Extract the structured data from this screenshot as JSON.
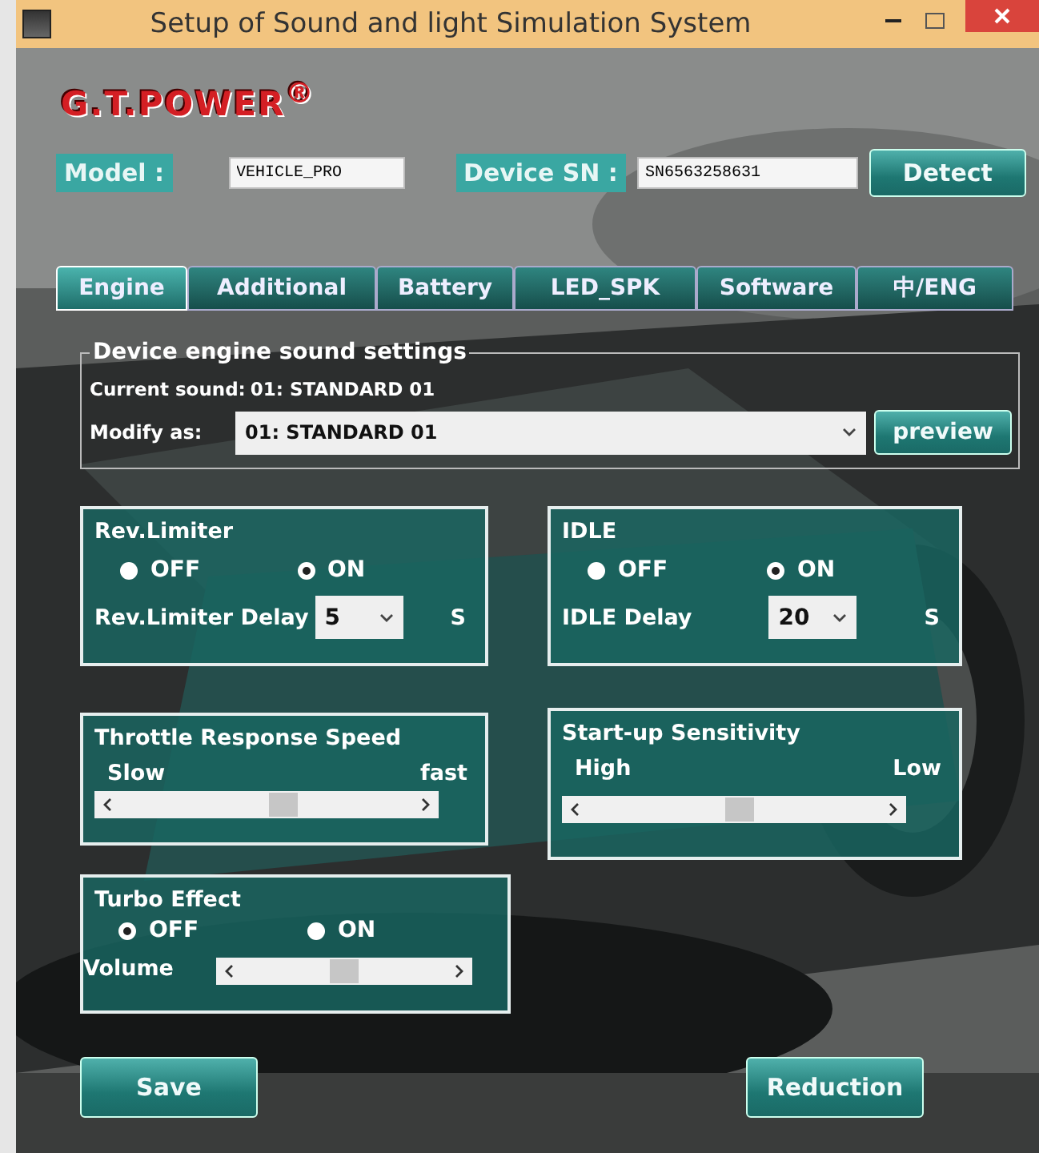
{
  "window": {
    "title": "Setup of Sound and light Simulation System"
  },
  "logo": {
    "text": "G.T.POWER$^{®}$"
  },
  "device": {
    "model_label": "Model :",
    "model_value": "VEHICLE_PRO",
    "sn_label": "Device SN :",
    "sn_value": "SN6563258631",
    "detect_button": "Detect"
  },
  "tabs": [
    {
      "label": "Engine",
      "selected": true
    },
    {
      "label": "Additional",
      "selected": false
    },
    {
      "label": "Battery",
      "selected": false
    },
    {
      "label": "LED_SPK",
      "selected": false
    },
    {
      "label": "Software",
      "selected": false
    },
    {
      "label": "中/ENG",
      "selected": false
    }
  ],
  "engine_sound": {
    "title": "Device engine sound settings",
    "current_label": "Current sound:",
    "current_value": "01: STANDARD 01",
    "modify_label": "Modify as:",
    "modify_value": "01: STANDARD 01",
    "preview_button": "preview"
  },
  "rev_limiter": {
    "title": "Rev.Limiter",
    "options": [
      {
        "label": "OFF",
        "selected": false
      },
      {
        "label": "ON",
        "selected": true
      }
    ],
    "delay_label": "Rev.Limiter Delay",
    "delay_value": "5",
    "unit": "S"
  },
  "idle": {
    "title": "IDLE",
    "options": [
      {
        "label": "OFF",
        "selected": false
      },
      {
        "label": "ON",
        "selected": true
      }
    ],
    "delay_label": "IDLE Delay",
    "delay_value": "20",
    "unit": "S"
  },
  "throttle_response": {
    "title": "Throttle Response Speed",
    "left_label": "Slow",
    "right_label": "fast",
    "level": 0.56
  },
  "startup_sensitivity": {
    "title": "Start-up Sensitivity",
    "left_label": "High",
    "right_label": "Low",
    "level": 0.52
  },
  "turbo_effect": {
    "title": "Turbo Effect",
    "options": [
      {
        "label": "OFF",
        "selected": true
      },
      {
        "label": "ON",
        "selected": false
      }
    ],
    "volume_label": "Volume",
    "level": 0.5
  },
  "buttons": [
    "Save",
    "Reduction"
  ]
}
